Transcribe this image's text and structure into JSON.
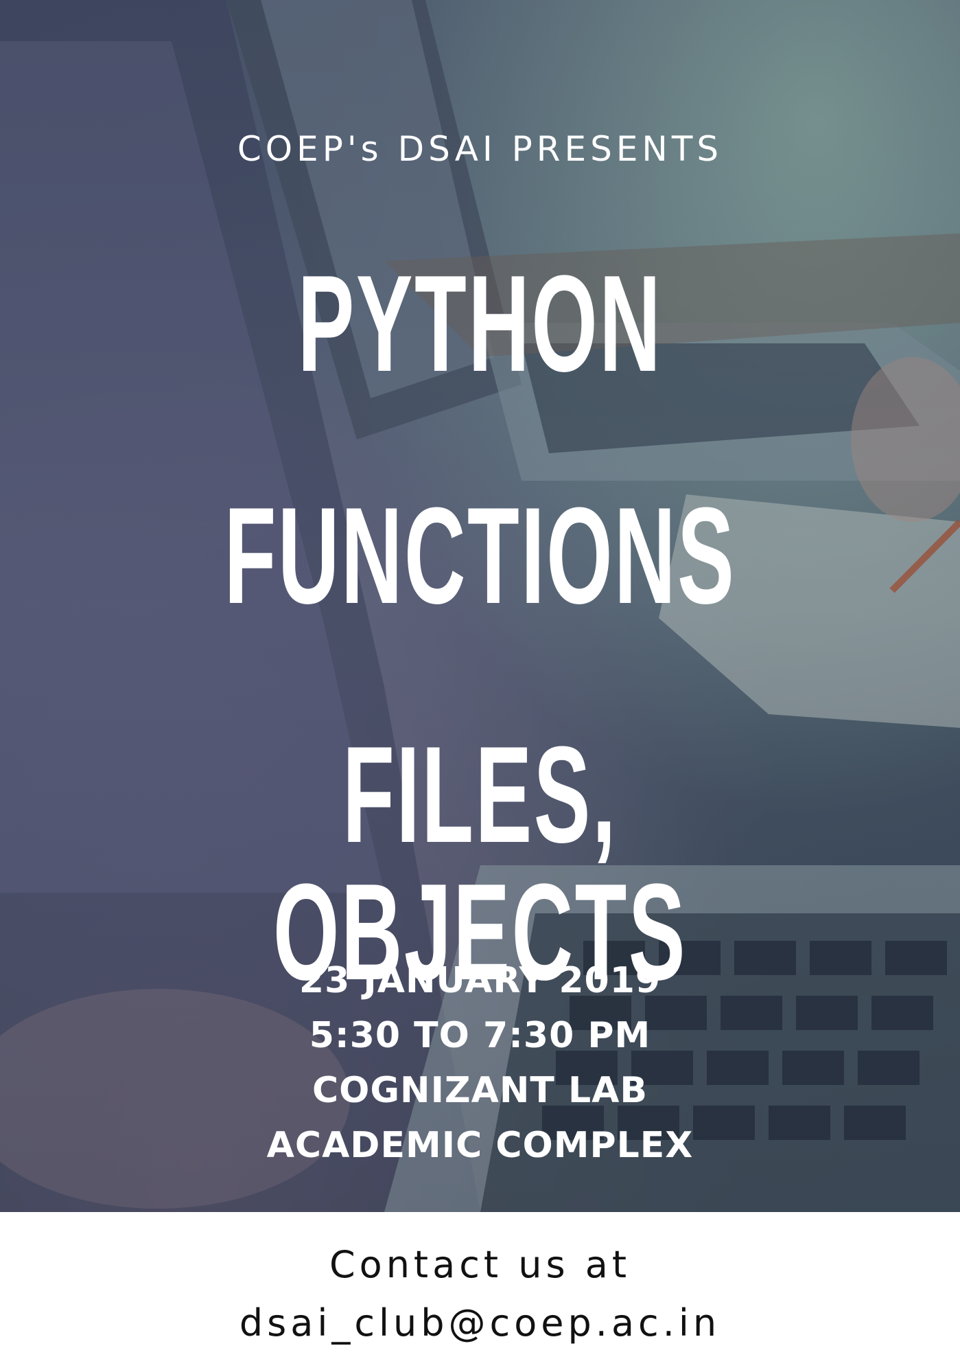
{
  "header": {
    "presents": "COEP's DSAI PRESENTS"
  },
  "title": {
    "line1": "PYTHON",
    "line2": "FUNCTIONS",
    "line3": "FILES, OBJECTS"
  },
  "event": {
    "date": "23 JANUARY 2019",
    "time": "5:30 TO 7:30 PM",
    "venue": "COGNIZANT LAB",
    "building": "ACADEMIC COMPLEX"
  },
  "contact": {
    "label": "Contact us at",
    "email": "dsai_club@coep.ac.in"
  },
  "colors": {
    "text_light": "#ffffff",
    "text_dark": "#111111",
    "footer_bg": "#ffffff"
  }
}
